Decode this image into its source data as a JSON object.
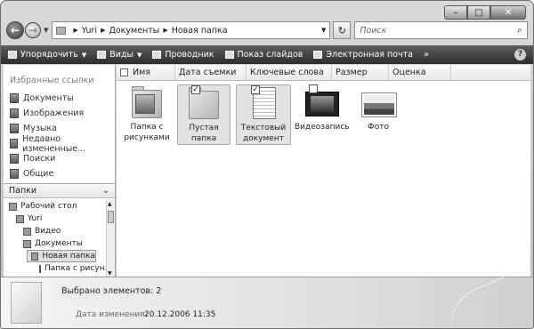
{
  "navigation": {
    "path": [
      "Yuri",
      "Документы",
      "Новая папка"
    ],
    "search_placeholder": "Поиск"
  },
  "toolbar": {
    "items": [
      {
        "label": "Упорядочить",
        "dropdown": true,
        "icon": "organize-icon"
      },
      {
        "label": "Виды",
        "dropdown": true,
        "icon": "views-icon"
      },
      {
        "label": "Проводник",
        "dropdown": false,
        "icon": "explorer-icon"
      },
      {
        "label": "Показ слайдов",
        "dropdown": false,
        "icon": "slideshow-icon"
      },
      {
        "label": "Электронная почта",
        "dropdown": false,
        "icon": "email-icon"
      }
    ],
    "more": "»",
    "help": "?"
  },
  "sidebar": {
    "favorites_title": "Избранные ссылки",
    "favorites": [
      "Документы",
      "Изображения",
      "Музыка",
      "Недавно измененные...",
      "Поиски",
      "Общие"
    ],
    "folders_label": "Папки",
    "tree": [
      {
        "label": "Рабочий стол",
        "level": 0
      },
      {
        "label": "Yuri",
        "level": 1
      },
      {
        "label": "Видео",
        "level": 2
      },
      {
        "label": "Документы",
        "level": 2
      },
      {
        "label": "Новая папка",
        "level": 3,
        "selected": true
      },
      {
        "label": "Папка с рисун...",
        "level": 4
      }
    ]
  },
  "columns": [
    "Имя",
    "Дата съемки",
    "Ключевые слова",
    "Размер",
    "Оценка"
  ],
  "files": [
    {
      "name": "Папка с рисунками",
      "type": "picture-folder",
      "selected": false,
      "checked": false
    },
    {
      "name": "Пустая папка",
      "type": "folder",
      "selected": true,
      "checked": true
    },
    {
      "name": "Текстовый документ",
      "type": "document",
      "selected": true,
      "checked": true
    },
    {
      "name": "Видеозапись",
      "type": "video",
      "selected": false,
      "checked": false
    },
    {
      "name": "Фото",
      "type": "photo",
      "selected": false,
      "checked": false
    }
  ],
  "details": {
    "selected_count": "Выбрано элементов: 2",
    "modified_label": "Дата изменения:",
    "modified_value": "20.12.2006 11:35"
  }
}
